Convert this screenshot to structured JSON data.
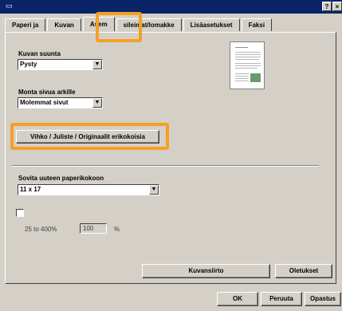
{
  "titlebar": {
    "buttons": [
      "?",
      "×"
    ],
    "icon": "printer-icon"
  },
  "tabs": [
    "Paperi ja",
    "Kuvan",
    "Asem",
    "sileimat/lomakke",
    "Lisäasetukset",
    "Faksi"
  ],
  "orientation": {
    "label": "Kuvan suunta",
    "value": "Pysty"
  },
  "pages_per_sheet": {
    "label": "Monta sivua arkille",
    "value": "Molemmat sivut"
  },
  "booklet_button": "Vihko / Juliste / Originaalit erikokoisia",
  "fit_to_paper": {
    "label": "Sovita uuteen paperikokoon",
    "value": "11 x 17"
  },
  "zoom": {
    "range": "25 to 400%",
    "value": "100",
    "unit": "%"
  },
  "image_shift_button": "Kuvansiirto",
  "defaults_button": "Oletukset",
  "footer": {
    "ok": "OK",
    "cancel": "Peruuta",
    "help": "Opastus"
  },
  "highlight_color": "#f5a023"
}
